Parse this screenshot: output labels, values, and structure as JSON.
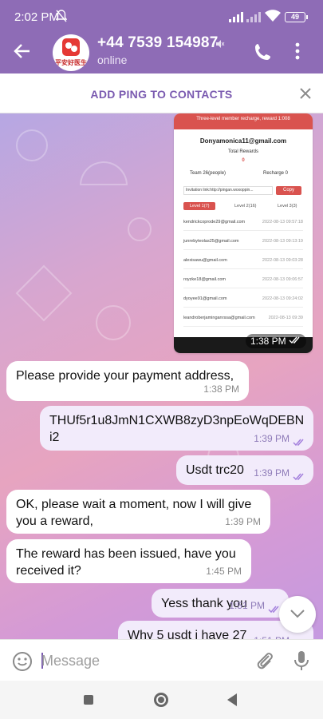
{
  "status_bar": {
    "time": "2:02 PM",
    "battery": "49"
  },
  "header": {
    "title": "+44 7539 154987",
    "status": "online",
    "avatar_text": "平安好医生"
  },
  "add_bar": {
    "label": "ADD PING TO CONTACTS"
  },
  "screenshot_message": {
    "time": "1:38 PM",
    "banner": "Three-level member recharge, reward 1:008",
    "email": "Donyamonica11@gmail.com",
    "total_label": "Total Rewards",
    "total_value": "0",
    "team_label": "Team 26(people)",
    "recharge_label": "Recharge 0",
    "invitation": "Invitation link:http://pingan.woxoppin...",
    "copy_label": "Copy",
    "tabs": [
      "Level 1(7)",
      "Level 2(16)",
      "Level 3(3)"
    ],
    "rows": [
      {
        "email": "kendrickcoprode29@gmail.com",
        "date": "2022-08-13 09:57:18"
      },
      {
        "email": "junrebyteolas25@gmail.com",
        "date": "2022-08-13 09:13:19"
      },
      {
        "email": "alexisawu@gmail.com",
        "date": "2022-08-13 09:03:28"
      },
      {
        "email": "royzke18@gmail.com",
        "date": "2022-08-13 09:06:57"
      },
      {
        "email": "dyoyee91@gmail.com",
        "date": "2022-08-13 09:24:02"
      },
      {
        "email": "leandroberjaminganrssa@gmail.com",
        "date": "2022-08-13 09:39"
      }
    ]
  },
  "messages": [
    {
      "dir": "in",
      "text": "Please provide your payment address,",
      "time": "1:38 PM"
    },
    {
      "dir": "out",
      "text": "THUf5r1u8JmN1CXWB8zyD3npEoWqDEBN i2",
      "time": "1:39 PM"
    },
    {
      "dir": "out",
      "text": "Usdt trc20",
      "time": "1:39 PM"
    },
    {
      "dir": "in",
      "text": "OK, please wait a moment, now I will give you a reward,",
      "time": "1:39 PM"
    },
    {
      "dir": "in",
      "text": "The reward has been issued, have you received it?",
      "time": "1:45 PM"
    },
    {
      "dir": "out",
      "text": "Yess thank you",
      "time": "1:51 PM"
    },
    {
      "dir": "out",
      "text": "Why 5 usdt i have 27",
      "time": "1:51 PM"
    }
  ],
  "input": {
    "placeholder": "Message"
  },
  "colors": {
    "header": "#8e6cb6",
    "accent": "#7a5ab0",
    "out_bubble": "#f2ebfb"
  }
}
